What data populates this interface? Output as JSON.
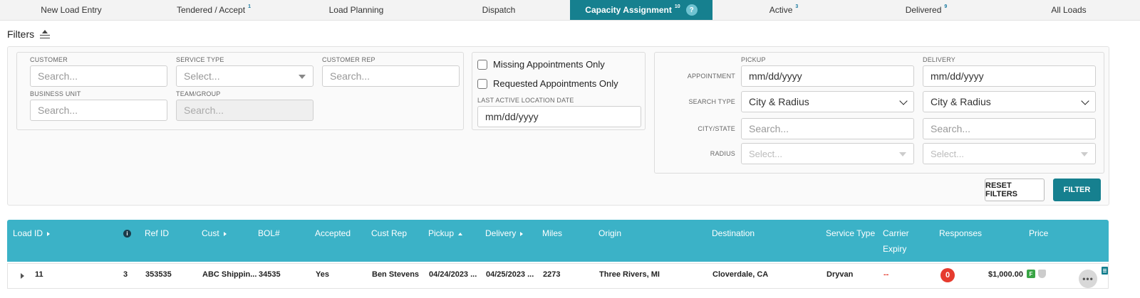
{
  "tabs": [
    {
      "label": "New Load Entry",
      "count": ""
    },
    {
      "label": "Tendered / Accept",
      "count": "1"
    },
    {
      "label": "Load Planning",
      "count": ""
    },
    {
      "label": "Dispatch",
      "count": ""
    },
    {
      "label": "Capacity Assignment",
      "count": "10",
      "help": "?"
    },
    {
      "label": "Active",
      "count": "3"
    },
    {
      "label": "Delivered",
      "count": "9"
    },
    {
      "label": "All Loads",
      "count": ""
    }
  ],
  "filters": {
    "title": "Filters",
    "customer": {
      "label": "CUSTOMER",
      "placeholder": "Search..."
    },
    "service_type": {
      "label": "SERVICE TYPE",
      "placeholder": "Select..."
    },
    "customer_rep": {
      "label": "CUSTOMER REP",
      "placeholder": "Search..."
    },
    "business_unit": {
      "label": "BUSINESS UNIT",
      "placeholder": "Search..."
    },
    "team_group": {
      "label": "TEAM/GROUP",
      "placeholder": "Search..."
    },
    "missing_appointments": "Missing Appointments Only",
    "requested_appointments": "Requested Appointments Only",
    "last_active_location_date": {
      "label": "LAST ACTIVE LOCATION DATE",
      "placeholder": "mm/dd/yyyy"
    },
    "pickup_header": "PICKUP",
    "delivery_header": "DELIVERY",
    "appointment_label": "APPOINTMENT",
    "search_type_label": "SEARCH TYPE",
    "city_state_label": "CITY/STATE",
    "radius_label": "RADIUS",
    "pickup": {
      "appointment": "mm/dd/yyyy",
      "search_type": "City & Radius",
      "city_state": "Search...",
      "radius": "Select..."
    },
    "delivery": {
      "appointment": "mm/dd/yyyy",
      "search_type": "City & Radius",
      "city_state": "Search...",
      "radius": "Select..."
    },
    "reset_button": "RESET FILTERS",
    "filter_button": "FILTER"
  },
  "table": {
    "headers": {
      "load_id": "Load ID",
      "info": "i",
      "ref_id": "Ref ID",
      "cust": "Cust",
      "bol": "BOL#",
      "accepted": "Accepted",
      "cust_rep": "Cust Rep",
      "pickup": "Pickup",
      "delivery": "Delivery",
      "miles": "Miles",
      "origin": "Origin",
      "destination": "Destination",
      "service_type": "Service Type",
      "carrier_expiry_1": "Carrier",
      "carrier_expiry_2": "Expiry",
      "responses": "Responses",
      "price": "Price"
    },
    "rows": [
      {
        "load_id": "11",
        "info": "3",
        "ref_id": "353535",
        "cust": "ABC Shippin...",
        "bol": "34535",
        "accepted": "Yes",
        "cust_rep": "Ben Stevens",
        "pickup": "04/24/2023 ...",
        "delivery": "04/25/2023 ...",
        "miles": "2273",
        "origin": "Three Rivers, MI",
        "destination": "Cloverdale, CA",
        "service_type": "Dryvan",
        "carrier_expiry": "--",
        "responses": "0",
        "price": "$1,000.00",
        "price_badge": "F",
        "more": "•••"
      }
    ]
  },
  "colors": {
    "accent": "#16808f",
    "table_header": "#3bb2c7",
    "danger": "#e63b2e",
    "badge_green": "#3aa545"
  }
}
